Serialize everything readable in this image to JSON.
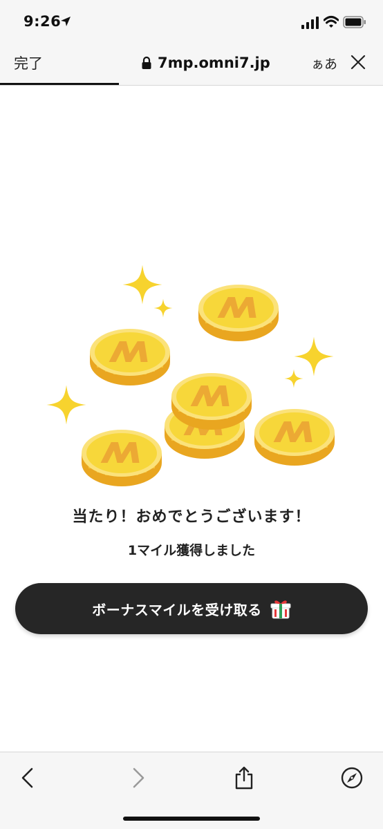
{
  "status_bar": {
    "time": "9:26"
  },
  "browser": {
    "done_label": "完了",
    "url": "7mp.omni7.jp",
    "text_size_label": "ぁあ",
    "load_progress": 0.31
  },
  "main": {
    "title": "当たり！おめでとうございます！",
    "subtitle": "1マイル獲得しました",
    "bonus_button_label": "ボーナスマイルを受け取る"
  },
  "colors": {
    "coin": "#f7d73a",
    "coin_dark": "#e9a620",
    "coin_letter": "#eca934",
    "sparkle": "#f7d32e",
    "button_bg": "#262626"
  },
  "icons": [
    "location-arrow-icon",
    "signal-icon",
    "wifi-icon",
    "battery-icon",
    "lock-icon",
    "close-icon",
    "gift-icon",
    "back-icon",
    "forward-icon",
    "share-icon",
    "safari-compass-icon"
  ]
}
